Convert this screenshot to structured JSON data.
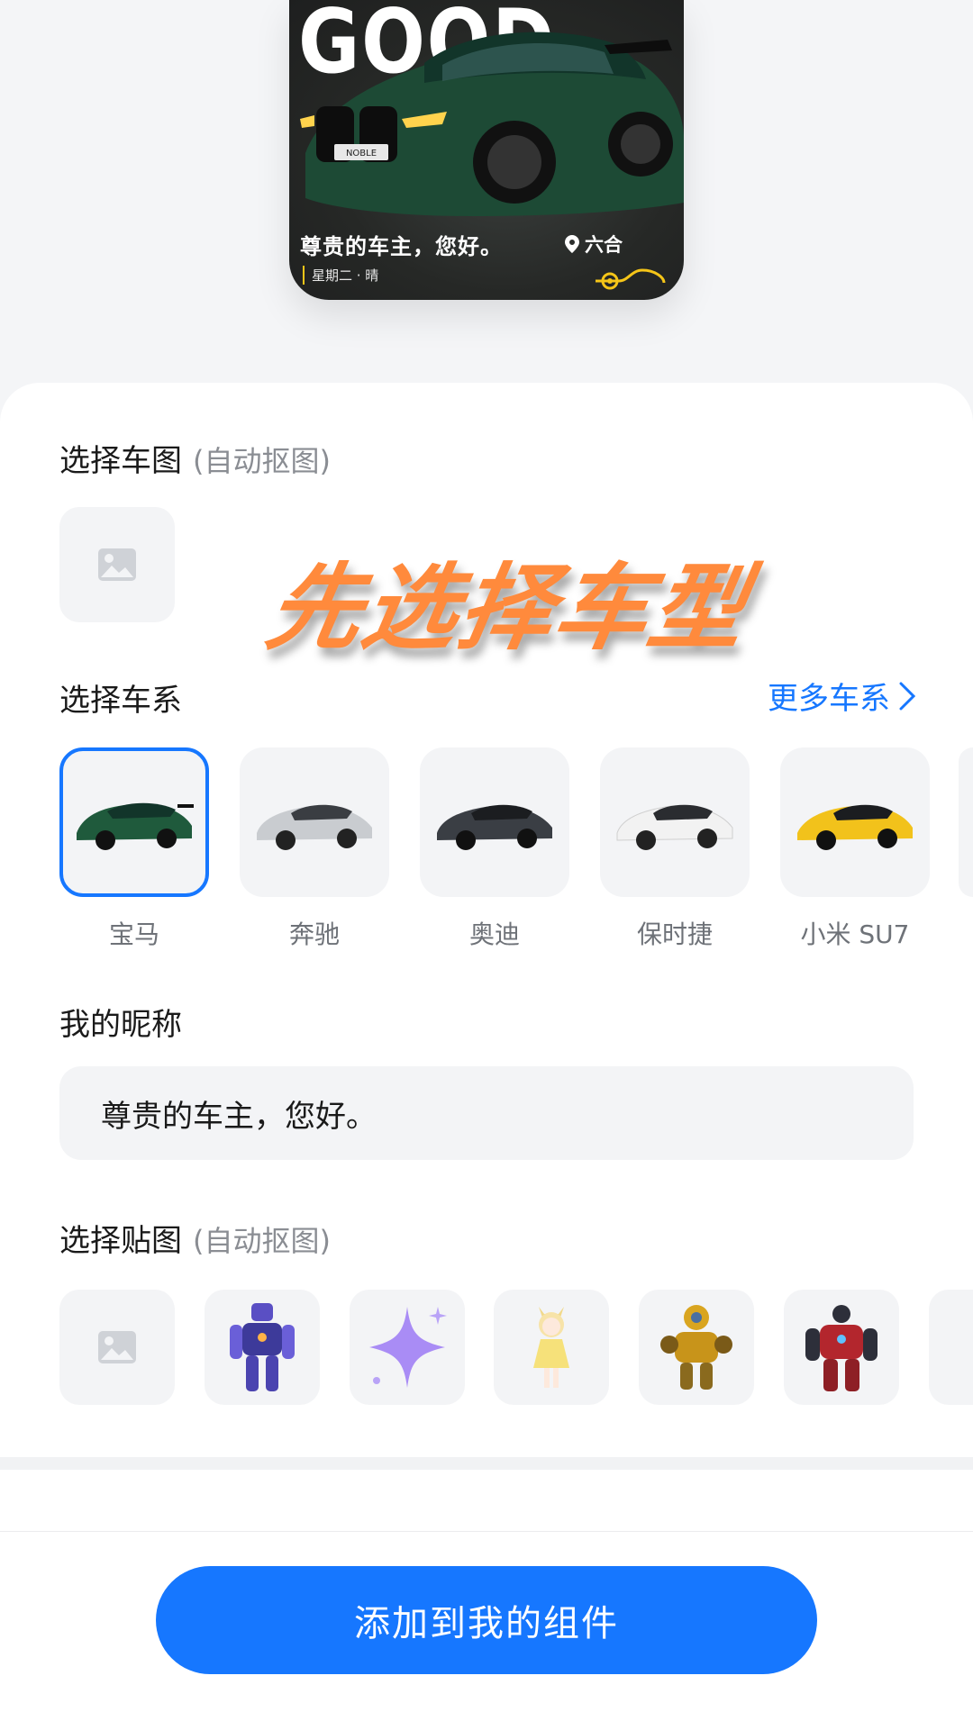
{
  "preview": {
    "big_text": "GOOD",
    "greeting": "尊贵的车主，您好。",
    "location": "六合",
    "date_weather": "星期二 · 晴",
    "badge_text": "NOBLE"
  },
  "car_image_section": {
    "title": "选择车图",
    "hint": "(自动抠图)"
  },
  "overlay_caption": "先选择车型",
  "series_section": {
    "title": "选择车系",
    "more_label": "更多车系",
    "brands": [
      {
        "label": "宝马",
        "color": "#1f5a3c",
        "selected": true
      },
      {
        "label": "奔驰",
        "color": "#c9ccd0",
        "selected": false
      },
      {
        "label": "奥迪",
        "color": "#3a3e44",
        "selected": false
      },
      {
        "label": "保时捷",
        "color": "#f2f2f2",
        "selected": false
      },
      {
        "label": "小米 SU7",
        "color": "#f2c21b",
        "selected": false
      }
    ]
  },
  "nickname_section": {
    "title": "我的昵称",
    "value": "尊贵的车主，您好。"
  },
  "sticker_section": {
    "title": "选择贴图",
    "hint": "(自动抠图)",
    "stickers": [
      "blue-robot",
      "purple-sparkle",
      "anime-cat-girl",
      "yellow-robot",
      "red-robot"
    ]
  },
  "primary_action": "添加到我的组件",
  "colors": {
    "accent": "#1677ff",
    "overlay": "#ff8a3c",
    "tile_bg": "#f3f4f6"
  }
}
